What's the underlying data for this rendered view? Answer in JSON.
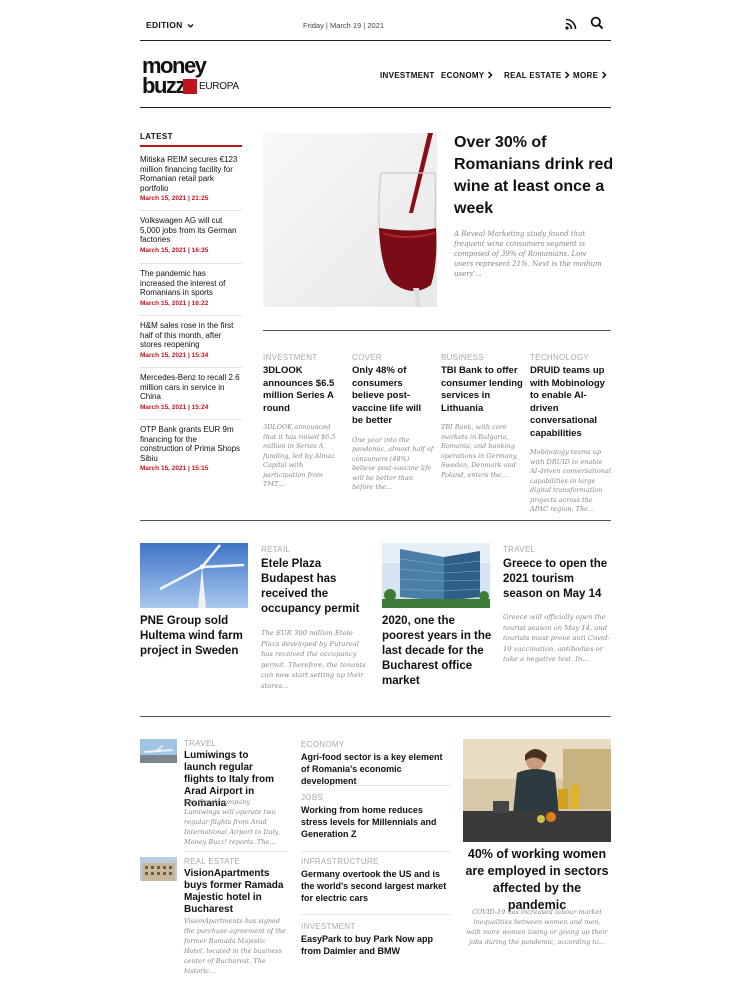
{
  "header": {
    "edition": "EDITION",
    "date": "Friday | March 19 | 2021"
  },
  "logo": {
    "line1": "money",
    "line2": "buzz",
    "line3": "EUROPA"
  },
  "nav": [
    {
      "label": "INVESTMENT",
      "has_dropdown": false
    },
    {
      "label": "ECONOMY",
      "has_dropdown": true
    },
    {
      "label": "REAL ESTATE",
      "has_dropdown": true
    },
    {
      "label": "MORE",
      "has_dropdown": true
    }
  ],
  "latest": {
    "heading": "LATEST",
    "items": [
      {
        "title": "Mitiska REIM secures €123 million financing facility for Romanian retail park portfolio",
        "date": "March 15, 2021 | 21:25"
      },
      {
        "title": "Volkswagen AG will cut 5,000 jobs from its German factories",
        "date": "March 15, 2021 | 16:35"
      },
      {
        "title": "The pandemic has increased the interest of Romanians in sports",
        "date": "March 15, 2021 | 16:22"
      },
      {
        "title": "H&M sales rose in the first half of this month, after stores reopening",
        "date": "March 15, 2021 | 15:34"
      },
      {
        "title": "Mercedes-Benz to recall 2.6 million cars in service in China",
        "date": "March 15, 2021 | 15:24"
      },
      {
        "title": "OTP Bank grants EUR 9m financing for the construction of Prima Shops Sibiu",
        "date": "March 15, 2021 | 15:15"
      }
    ]
  },
  "hero": {
    "title": "Over 30% of Romanians drink red wine at least once a week",
    "excerpt": "A Reveal Marketing study found that frequent wine consumers segment is composed of 39% of Romanians. Low users represent 21%. Next is the medium users'..."
  },
  "four": [
    {
      "category": "INVESTMENT",
      "title": "3DLOOK announces $6.5 million Series A round",
      "excerpt": "3DLOOK announced that it has raised $6.5 million in Series A funding, led by Almaz Capital with participation from TMT..."
    },
    {
      "category": "COVER",
      "title": "Only 48% of consumers believe post-vaccine life will be better",
      "excerpt": "One year into the pandemic, almost half of consumers (48%) believe post-vaccine life will be better than before the..."
    },
    {
      "category": "BUSINESS",
      "title": "TBI Bank to offer consumer lending services in Lithuania",
      "excerpt": "TBI Bank, with core markets in Bulgaria, Romania, and banking operations in Germany, Sweden, Denmark and Poland, enters the..."
    },
    {
      "category": "TECHNOLOGY",
      "title": "DRUID teams up with Mobinology to enable AI-driven conversational capabilities",
      "excerpt": "Mobinology teams up with DRUID to enable AI-driven conversational capabilities in large digital transformation projects across the APAC region.  The..."
    }
  ],
  "mid": {
    "wind": {
      "title": "PNE Group sold Hultema wind farm project in Sweden"
    },
    "etele": {
      "category": "RETAIL",
      "title": "Etele Plaza Budapest has received the occupancy permit",
      "excerpt": "The EUR 300 million Etele Plaza developed by Futureal has received the occupancy permit. Therefore, the tenants can now start setting up their stores..."
    },
    "office": {
      "title": "2020, one the poorest years in the last decade for the Bucharest office market"
    },
    "greece": {
      "category": "TRAVEL",
      "title": "Greece to open the 2021 tourism season on May 14",
      "excerpt": "Greece will officially open the tourist season on May 14, and tourists must prove anti Covid-19 vaccination, antibodies or take a negative test. In..."
    }
  },
  "bottom_left": [
    {
      "category": "TRAVEL",
      "title": "Lumiwings to launch regular flights to Italy from Arad Airport in Romania",
      "excerpt": "The Greek company Lumiwings will operate two regular flights from Arad International Airport to Italy, Money Buzz! reports. The..."
    },
    {
      "category": "REAL ESTATE",
      "title": "VisionApartments buys former Ramada Majestic hotel in Bucharest",
      "excerpt": "VisionApartments has signed the purchase agreement of the former Ramada Majestic Hotel, located in the business center of Bucharest. The historic..."
    }
  ],
  "bottom_center": [
    {
      "category": "ECONOMY",
      "title": "Agri-food sector is a key element of Romania's economic development"
    },
    {
      "category": "JOBS",
      "title": "Working from home reduces stress levels for Millennials and Generation Z"
    },
    {
      "category": "INFRASTRUCTURE",
      "title": "Germany overtook the US and is the world's second largest market for electric cars"
    },
    {
      "category": "INVESTMENT",
      "title": "EasyPark to buy Park Now app from Daimler and BMW"
    }
  ],
  "bottom_right": {
    "title": "40% of working women are employed in sectors affected by the pandemic",
    "excerpt": "COVID-19 has increased labour market inequalities between women and men, with more women losing or giving up their jobs during the pandemic, according to..."
  },
  "colors": {
    "accent": "#c1121f"
  }
}
